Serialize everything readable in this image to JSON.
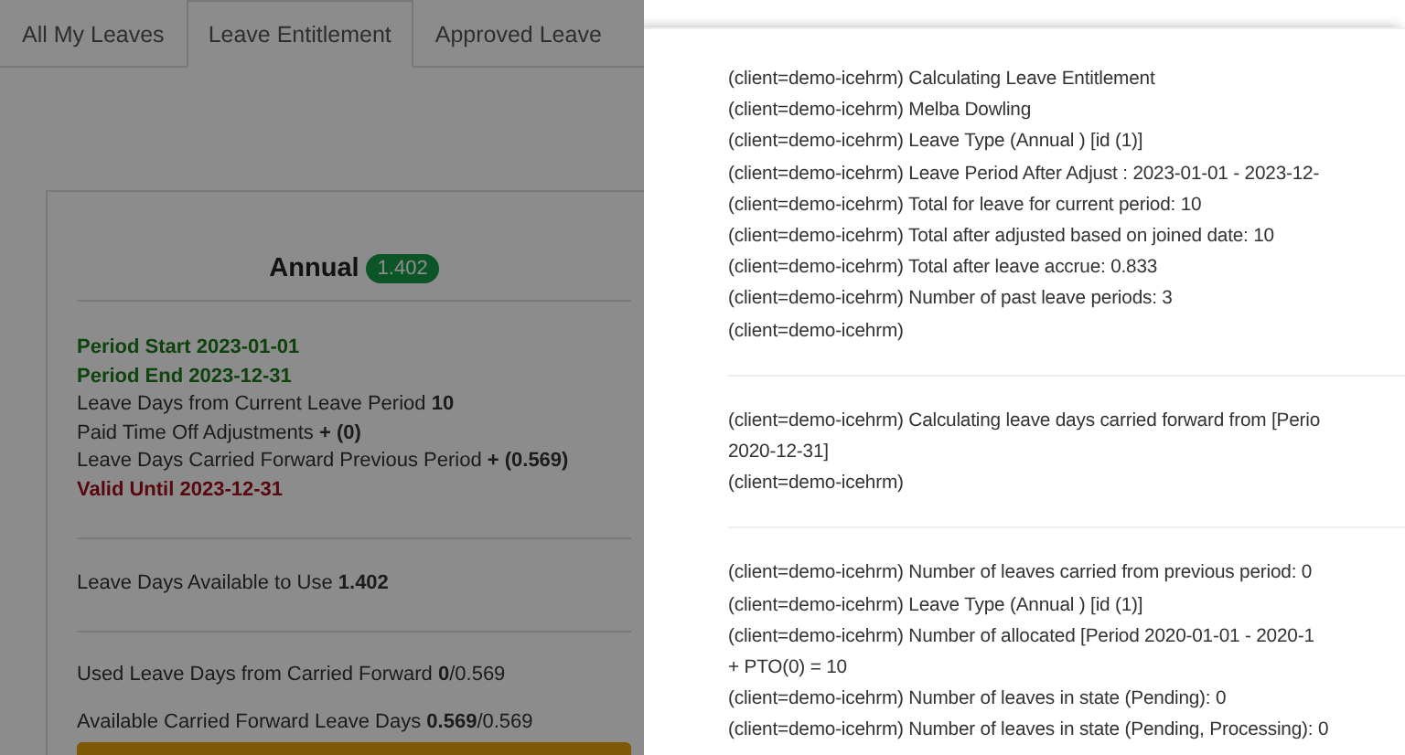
{
  "tabs": [
    {
      "label": "All My Leaves",
      "selected": false
    },
    {
      "label": "Leave Entitlement",
      "selected": true
    },
    {
      "label": "Approved Leave",
      "selected": false
    }
  ],
  "card": {
    "title": "Annual",
    "badge": "1.402",
    "period_lines": [
      {
        "text": "Period Start 2023-01-01",
        "kind": "good"
      },
      {
        "text": "Period End 2023-12-31",
        "kind": "good"
      },
      {
        "text": "Leave Days from Current Leave Period **10**",
        "kind": "plain"
      },
      {
        "text": "Paid Time Off Adjustments **+ (0)**",
        "kind": "plain"
      },
      {
        "text": "Leave Days Carried Forward Previous Period **+ (0.569)**",
        "kind": "plain"
      },
      {
        "text": "Valid Until 2023-12-31",
        "kind": "bad"
      }
    ],
    "available": "Leave Days Available to Use **1.402**",
    "used_carried": "Used Leave Days from Carried Forward **0**/0.569",
    "available_carried": "Available Carried Forward Leave Days **0.569**/0.569"
  },
  "log_sections": [
    {
      "lines": [
        "(client=demo-icehrm) Calculating Leave Entitlement",
        "(client=demo-icehrm) Melba Dowling",
        "(client=demo-icehrm) Leave Type (Annual ) [id (1)]",
        "(client=demo-icehrm) Leave Period After Adjust : 2023-01-01 - 2023-12-",
        "(client=demo-icehrm) Total for leave for current period: 10",
        "(client=demo-icehrm) Total after adjusted based on joined date: 10",
        "(client=demo-icehrm) Total after leave accrue: 0.833",
        "(client=demo-icehrm) Number of past leave periods: 3",
        "(client=demo-icehrm)"
      ]
    },
    {
      "lines": [
        "(client=demo-icehrm) Calculating leave days carried forward from [Perio",
        "2020-12-31]",
        "(client=demo-icehrm)"
      ]
    },
    {
      "lines": [
        "(client=demo-icehrm) Number of leaves carried from previous period: 0",
        "(client=demo-icehrm) Leave Type (Annual ) [id (1)]",
        "(client=demo-icehrm) Number of allocated [Period 2020-01-01 - 2020-1",
        "+ PTO(0) = 10",
        "(client=demo-icehrm) Number of leaves in state (Pending): 0",
        "(client=demo-icehrm) Number of leaves in state (Pending, Processing): 0"
      ]
    }
  ]
}
